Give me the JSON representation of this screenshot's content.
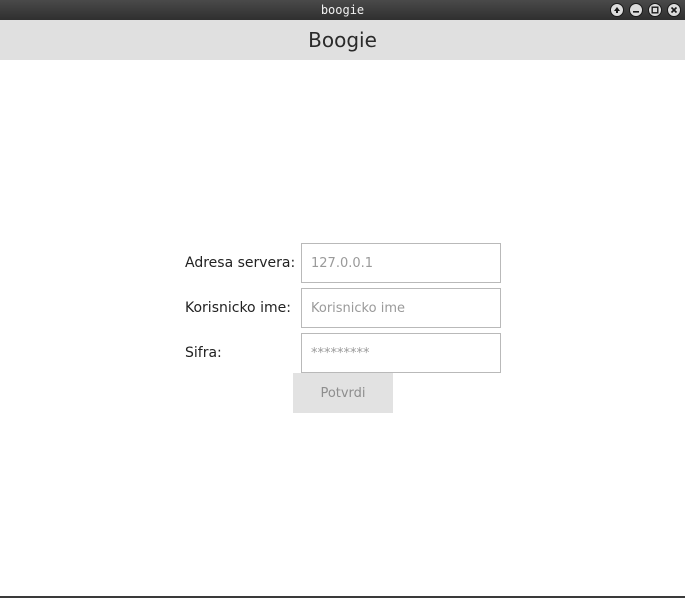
{
  "window": {
    "title": "boogie"
  },
  "header": {
    "title": "Boogie"
  },
  "form": {
    "server_label": "Adresa servera:",
    "server_placeholder": "127.0.0.1",
    "username_label": "Korisnicko ime:",
    "username_placeholder": "Korisnicko ime",
    "password_label": "Sifra:",
    "password_placeholder": "*********",
    "submit_label": "Potvrdi"
  },
  "icons": {
    "window_buttons": [
      "arrow-up-icon",
      "minimize-icon",
      "maximize-icon",
      "close-icon"
    ]
  },
  "colors": {
    "titlebar": "#3a3a3a",
    "header_bg": "#e0e0e0",
    "button_bg": "#e2e2e2",
    "input_border": "#b9b9b9"
  }
}
